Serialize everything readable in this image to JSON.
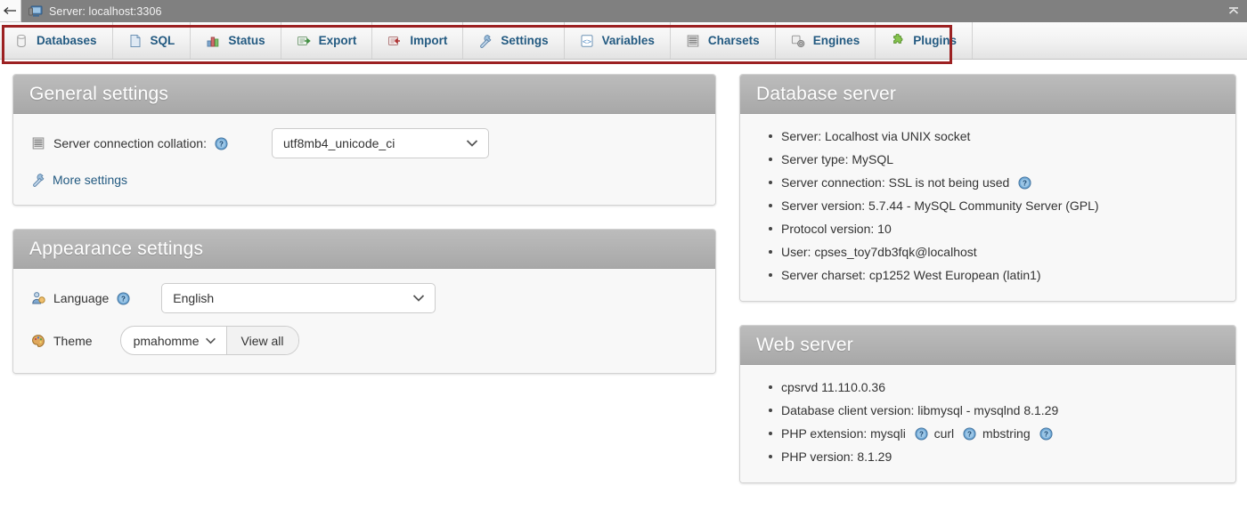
{
  "titlebar": {
    "back_icon": "back-arrow-icon",
    "server_icon": "server-monitor-icon",
    "text": "Server: localhost:3306",
    "collapse_icon": "collapse-up-icon"
  },
  "nav": {
    "annotation_color": "#9c2122",
    "items": [
      {
        "label": "Databases",
        "icon": "database-icon"
      },
      {
        "label": "SQL",
        "icon": "sql-document-icon"
      },
      {
        "label": "Status",
        "icon": "status-chart-icon"
      },
      {
        "label": "Export",
        "icon": "export-icon"
      },
      {
        "label": "Import",
        "icon": "import-icon"
      },
      {
        "label": "Settings",
        "icon": "wrench-icon"
      },
      {
        "label": "Variables",
        "icon": "variables-code-icon"
      },
      {
        "label": "Charsets",
        "icon": "charsets-lines-icon"
      },
      {
        "label": "Engines",
        "icon": "engines-gear-icon"
      },
      {
        "label": "Plugins",
        "icon": "plugin-puzzle-icon"
      }
    ]
  },
  "general_settings": {
    "title": "General settings",
    "collation_icon": "charsets-lines-icon",
    "collation_label": "Server connection collation:",
    "collation_help": "help-icon",
    "collation_value": "utf8mb4_unicode_ci",
    "more_settings_icon": "wrench-icon",
    "more_settings_label": "More settings"
  },
  "appearance_settings": {
    "title": "Appearance settings",
    "language_icon": "language-user-icon",
    "language_label": "Language",
    "language_help": "help-icon",
    "language_value": "English",
    "theme_icon": "theme-palette-icon",
    "theme_label": "Theme",
    "theme_value": "pmahomme",
    "view_all_label": "View all"
  },
  "database_server": {
    "title": "Database server",
    "items": [
      "Server: Localhost via UNIX socket",
      "Server type: MySQL",
      "Server connection: SSL is not being used",
      "Server version: 5.7.44 - MySQL Community Server (GPL)",
      "Protocol version: 10",
      "User: cpses_toy7db3fqk@localhost",
      "Server charset: cp1252 West European (latin1)"
    ]
  },
  "web_server": {
    "title": "Web server",
    "items_line1": "cpsrvd 11.110.0.36",
    "items_line2": "Database client version: libmysql - mysqlnd 8.1.29",
    "php_ext_label": "PHP extension: mysqli",
    "php_ext_curl": "curl",
    "php_ext_mbstring": "mbstring",
    "php_version": "PHP version: 8.1.29"
  }
}
